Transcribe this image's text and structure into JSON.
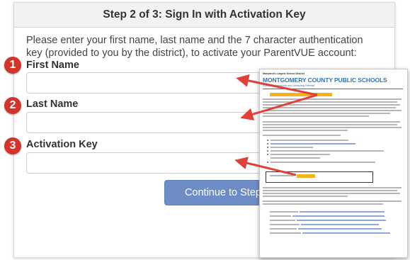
{
  "card": {
    "title": "Step 2 of 3: Sign In with Activation Key",
    "intro": "Please enter your first name, last name and the 7 character authentication key (provided to you by the district), to activate your ParentVUE account:",
    "fields": [
      {
        "label": "First Name",
        "value": "",
        "marker": "1"
      },
      {
        "label": "Last Name",
        "value": "",
        "marker": "2"
      },
      {
        "label": "Activation Key",
        "value": "",
        "marker": "3"
      }
    ],
    "continue_label": "Continue to Step 3"
  },
  "letter": {
    "org": "Maryland's Largest School District",
    "school": "MONTGOMERY COUNTY PUBLIC SCHOOLS",
    "motto": "Expanding Opportunity and Unleashing Potential"
  },
  "colors": {
    "marker_red": "#d3342a",
    "button_blue": "#6e8dc6",
    "arrow_red": "#e0403a",
    "highlight_yellow": "#f6b21b",
    "mcps_blue": "#2f74b5"
  }
}
